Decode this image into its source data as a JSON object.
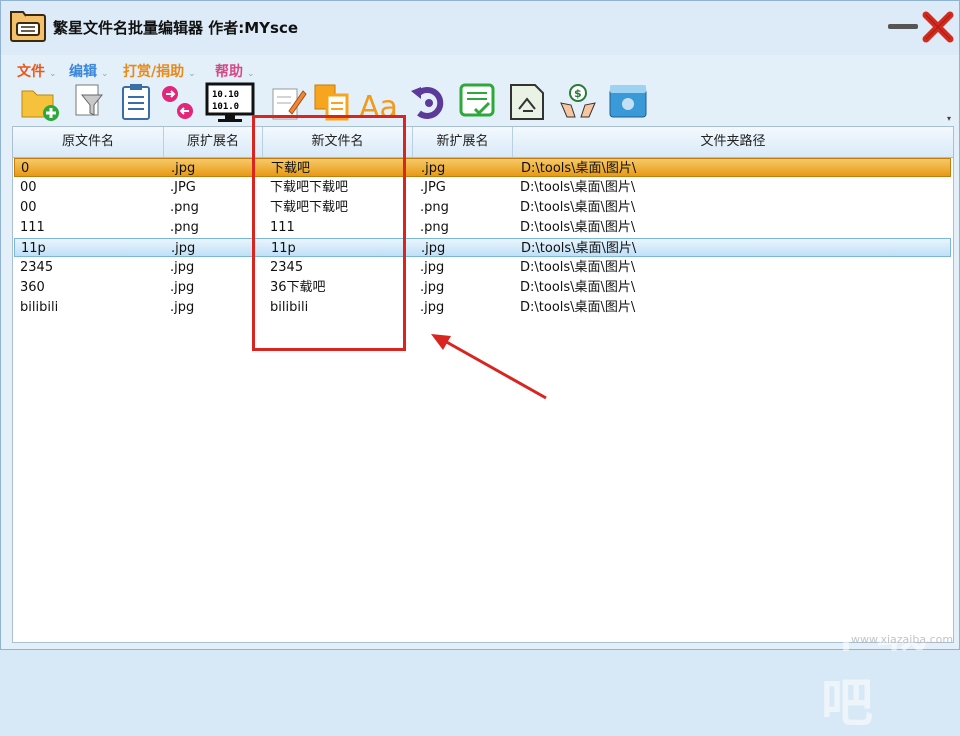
{
  "window": {
    "title": "繁星文件名批量编辑器  作者:MYsce"
  },
  "menu": [
    {
      "label": "文件",
      "color": "#e8581a"
    },
    {
      "label": "编辑",
      "color": "#3a86d8"
    },
    {
      "label": "打赏/捐助",
      "color": "#e88a1a"
    },
    {
      "label": "帮助",
      "color": "#d44a86"
    }
  ],
  "toolbar": {
    "icons": [
      "add-folder-icon",
      "filter-icon",
      "clipboard-icon",
      "swap-arrows-icon",
      "binary-numbers-icon",
      "edit-doc-icon",
      "copy-doc-icon",
      "font-case-icon",
      "undo-icon",
      "checklist-icon",
      "rename-doc-icon",
      "donate-icon",
      "settings-box-icon"
    ],
    "more": "▾"
  },
  "table": {
    "headers": [
      "原文件名",
      "原扩展名",
      "新文件名",
      "新扩展名",
      "文件夹路径"
    ],
    "rows": [
      {
        "orig_name": "0",
        "orig_ext": ".jpg",
        "new_name": "下载吧",
        "new_ext": ".jpg",
        "path": "D:\\tools\\桌面\\图片\\",
        "state": "orange"
      },
      {
        "orig_name": "00",
        "orig_ext": ".JPG",
        "new_name": "下载吧下载吧",
        "new_ext": ".JPG",
        "path": "D:\\tools\\桌面\\图片\\",
        "state": ""
      },
      {
        "orig_name": "00",
        "orig_ext": ".png",
        "new_name": "下载吧下载吧",
        "new_ext": ".png",
        "path": "D:\\tools\\桌面\\图片\\",
        "state": ""
      },
      {
        "orig_name": "111",
        "orig_ext": ".png",
        "new_name": "111",
        "new_ext": ".png",
        "path": "D:\\tools\\桌面\\图片\\",
        "state": ""
      },
      {
        "orig_name": "11p",
        "orig_ext": ".jpg",
        "new_name": "11p",
        "new_ext": ".jpg",
        "path": "D:\\tools\\桌面\\图片\\",
        "state": "blue"
      },
      {
        "orig_name": "2345",
        "orig_ext": ".jpg",
        "new_name": "2345",
        "new_ext": ".jpg",
        "path": "D:\\tools\\桌面\\图片\\",
        "state": ""
      },
      {
        "orig_name": "360",
        "orig_ext": ".jpg",
        "new_name": "36下载吧",
        "new_ext": ".jpg",
        "path": "D:\\tools\\桌面\\图片\\",
        "state": ""
      },
      {
        "orig_name": "bilibili",
        "orig_ext": ".jpg",
        "new_name": "bilibili",
        "new_ext": ".jpg",
        "path": "D:\\tools\\桌面\\图片\\",
        "state": ""
      }
    ]
  },
  "watermark": {
    "text": "下载吧",
    "sub": "www.xiazaiba.com"
  }
}
